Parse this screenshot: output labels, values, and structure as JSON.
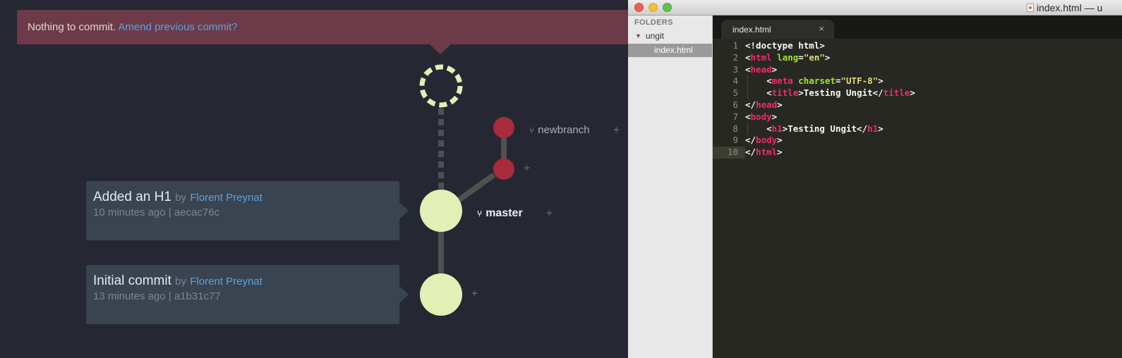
{
  "ungit": {
    "banner": {
      "text": "Nothing to commit.",
      "link": "Amend previous commit?"
    },
    "commits": [
      {
        "title": "Added an H1",
        "by": "by",
        "author": "Florent Preynat",
        "time": "10 minutes ago",
        "sep": "|",
        "hash": "aecac76c"
      },
      {
        "title": "Initial commit",
        "by": "by",
        "author": "Florent Preynat",
        "time": "13 minutes ago",
        "sep": "|",
        "hash": "a1b31c77"
      }
    ],
    "branches": {
      "newbranch": "newbranch",
      "master": "master"
    },
    "plus": "+",
    "colors": {
      "node": "#e2f0b6",
      "branch_node": "#a82c3c",
      "line": "#505050",
      "banner": "#6c3a48",
      "link": "#5aa3e0"
    }
  },
  "editor": {
    "window_title": "index.html — u",
    "sidebar": {
      "header": "FOLDERS",
      "folder": "ungit",
      "file": "index.html"
    },
    "tab": {
      "label": "index.html",
      "close": "×"
    },
    "line_numbers": [
      "1",
      "2",
      "3",
      "4",
      "5",
      "6",
      "7",
      "8",
      "9",
      "10"
    ],
    "code_lines": [
      "<!doctype html>",
      "<html lang=\"en\">",
      "<head>",
      "    <meta charset=\"UTF-8\">",
      "    <title>Testing Ungit</title>",
      "</head>",
      "<body>",
      "    <h1>Testing Ungit</h1>",
      "</body>",
      "</html>"
    ]
  }
}
